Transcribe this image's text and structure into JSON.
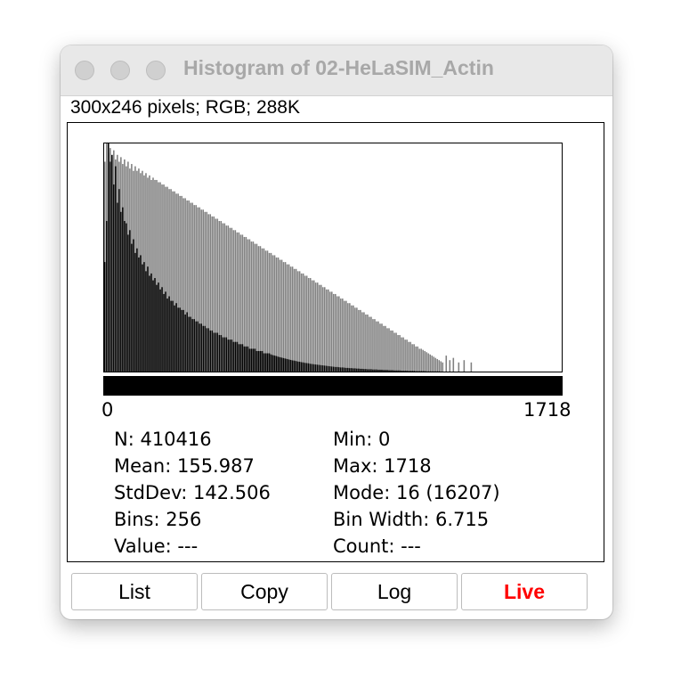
{
  "window": {
    "title": "Histogram of 02-HeLaSIM_Actin"
  },
  "info_line": "300x246 pixels; RGB; 288K",
  "axis": {
    "min_label": "0",
    "max_label": "1718"
  },
  "stats": {
    "left": [
      "N: 410416",
      "Mean: 155.987",
      "StdDev: 142.506",
      "Bins: 256",
      "Value: ---"
    ],
    "right": [
      "Min: 0",
      "Max: 1718",
      "Mode: 16 (16207)",
      "Bin Width: 6.715",
      "Count: ---"
    ]
  },
  "buttons": {
    "list": "List",
    "copy": "Copy",
    "log": "Log",
    "live": "Live"
  },
  "colors": {
    "live_text": "#ff0000",
    "histogram_fill": "#000000",
    "log_overlay_fill": "#808080",
    "lut_bar": "#000000"
  },
  "chart_data": {
    "type": "bar",
    "bins": 256,
    "x_range": [
      0,
      1718
    ],
    "y_max": 16207,
    "mode_bin": 2,
    "series": [
      {
        "name": "Count",
        "color": "#000000",
        "values_pct": [
          48,
          66,
          100,
          92,
          95,
          82,
          90,
          74,
          80,
          70,
          72,
          66,
          65,
          60,
          62,
          56,
          58,
          52,
          54,
          50,
          51,
          47,
          48,
          44,
          46,
          42,
          43,
          40,
          41,
          38,
          39,
          36,
          37,
          34,
          35,
          32,
          33,
          31,
          31,
          29,
          30,
          28,
          28,
          27,
          27,
          25,
          26,
          24,
          24,
          23,
          23,
          22,
          22,
          21,
          21,
          20,
          20,
          19,
          19,
          18,
          18,
          17,
          17,
          17,
          16,
          16,
          15,
          15,
          15,
          14,
          14,
          14,
          13,
          13,
          13,
          12,
          12,
          12,
          11,
          11,
          11,
          10,
          10,
          10,
          10,
          9,
          9,
          9,
          9,
          8,
          8,
          8,
          8,
          7.5,
          7.2,
          7,
          6.8,
          6.5,
          6.3,
          6.1,
          5.9,
          5.7,
          5.5,
          5.3,
          5.1,
          4.9,
          4.8,
          4.6,
          4.4,
          4.3,
          4.1,
          4,
          3.8,
          3.7,
          3.6,
          3.4,
          3.3,
          3.2,
          3.1,
          3,
          2.9,
          2.8,
          2.7,
          2.6,
          2.5,
          2.4,
          2.3,
          2.2,
          2.1,
          2,
          2,
          1.9,
          1.8,
          1.8,
          1.7,
          1.6,
          1.6,
          1.5,
          1.5,
          1.4,
          1.4,
          1.3,
          1.3,
          1.2,
          1.2,
          1.1,
          1.1,
          1,
          1,
          1,
          0.9,
          0.9,
          0.9,
          0.8,
          0.8,
          0.8,
          0.7,
          0.7,
          0.7,
          0.6,
          0.6,
          0.6,
          0.5,
          0.5,
          0.5,
          0.5,
          0.4,
          0.4,
          0.4,
          0.4,
          0.3,
          0.3,
          0.3,
          0.3,
          0.2,
          0.2,
          0.2,
          0.2,
          0.2,
          0.2,
          0.1,
          0.1,
          0.1,
          0.1,
          0.1,
          0.1,
          0.1,
          0.1,
          0,
          0,
          0,
          0,
          0,
          0,
          0,
          0,
          0,
          0,
          0,
          0,
          0,
          0,
          0,
          0,
          0,
          0,
          0,
          0,
          0,
          0,
          0,
          0,
          0,
          0,
          0,
          0,
          0,
          0,
          0,
          0,
          0,
          0,
          0,
          0,
          0,
          0,
          0,
          0,
          0,
          0,
          0,
          0,
          0,
          0,
          0,
          0,
          0,
          0,
          0,
          0,
          0,
          0,
          0,
          0,
          0,
          0,
          0,
          0,
          0,
          0,
          0,
          0,
          0,
          0,
          0,
          0,
          0,
          0,
          0,
          0,
          0,
          0,
          0,
          0,
          0,
          0,
          0,
          0
        ]
      },
      {
        "name": "Log",
        "color": "#808080",
        "values_pct": [
          92,
          100,
          96,
          98,
          94,
          97,
          93,
          95,
          92,
          94,
          91,
          93,
          90,
          92,
          89,
          91,
          88,
          90,
          88,
          89,
          87,
          88,
          86,
          87,
          85,
          86,
          84,
          85,
          84,
          84,
          83,
          83,
          82,
          82,
          81,
          81,
          80,
          80,
          79,
          79,
          78,
          78,
          77,
          77,
          76,
          76,
          75,
          75,
          74,
          74,
          73,
          73,
          72,
          72,
          71,
          71,
          70,
          70,
          69,
          69,
          68,
          68,
          67,
          67,
          66,
          66,
          65,
          65,
          64,
          64,
          63,
          63,
          62,
          62,
          61,
          61,
          60,
          60,
          59,
          59,
          58,
          58,
          57,
          57,
          56,
          56,
          55,
          55,
          54,
          54,
          53,
          53,
          52,
          52,
          51,
          51,
          50,
          50,
          49,
          49,
          48,
          48,
          47,
          47,
          46,
          46,
          45,
          45,
          44,
          44,
          43,
          43,
          42,
          42,
          41,
          41,
          40,
          40,
          39,
          39,
          38,
          38,
          37,
          37,
          36,
          36,
          35,
          35,
          34,
          34,
          33,
          33,
          32,
          32,
          31,
          31,
          30,
          30,
          29,
          29,
          28,
          28,
          27,
          27,
          26,
          26,
          25,
          25,
          24,
          24,
          23,
          23,
          22,
          22,
          21,
          21,
          20,
          20,
          19,
          19,
          18,
          18,
          17,
          17,
          16,
          16,
          15,
          15,
          14,
          14,
          13,
          13,
          12,
          12,
          11,
          11,
          10,
          10,
          9.5,
          9,
          8.5,
          8,
          7.5,
          7,
          6.5,
          6,
          5.5,
          5,
          4.5,
          4,
          0,
          7,
          0,
          5,
          0,
          6,
          0,
          0,
          4,
          0,
          0,
          5,
          0,
          0,
          0,
          4,
          0,
          0,
          0,
          0,
          0,
          0,
          0,
          0,
          0,
          0,
          0,
          0,
          0,
          0,
          0,
          0,
          0,
          0,
          0,
          0,
          0,
          0,
          0,
          0,
          0,
          0,
          0,
          0,
          0,
          0,
          0,
          0,
          0,
          0,
          0,
          0,
          0,
          0,
          0,
          0,
          0,
          0,
          0,
          0,
          0,
          0,
          0,
          0,
          0,
          0,
          0,
          0,
          0,
          0,
          0,
          0,
          0,
          0,
          0,
          0,
          0,
          0,
          0,
          0
        ]
      }
    ]
  }
}
